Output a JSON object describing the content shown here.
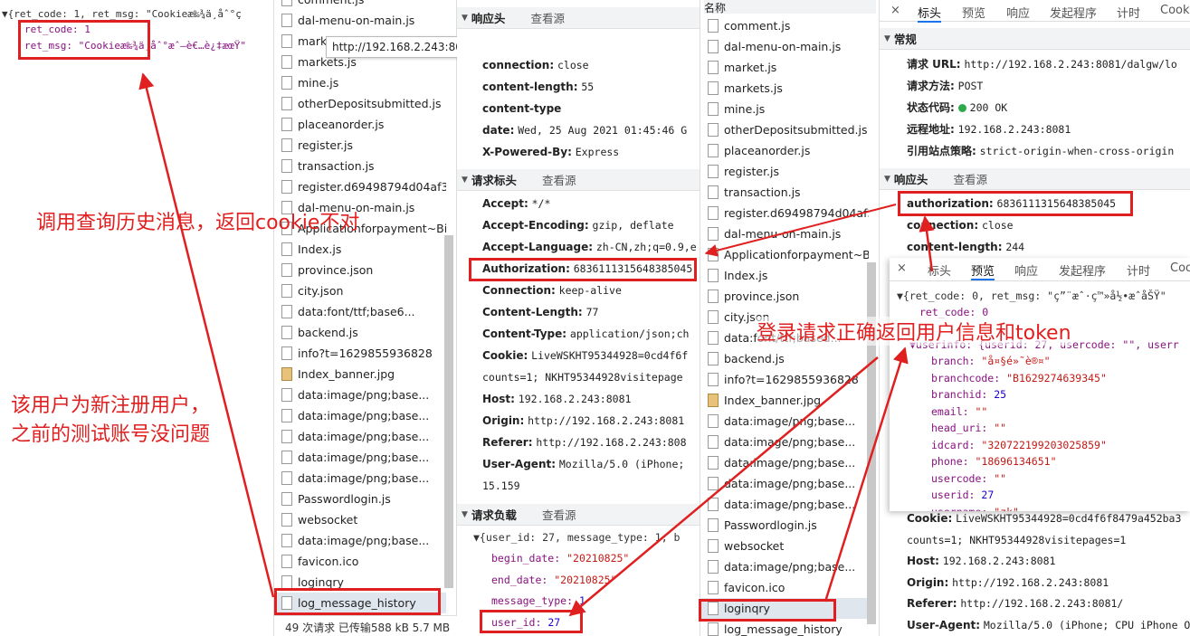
{
  "left_json": {
    "summary": "▼{ret_code: 1, ret_msg: \"Cookieæ‰¾ä¸åˆ°ç",
    "line1": "ret_code: 1",
    "line2": "ret_msg: \"Cookieæ‰¾ä¸åˆ°æˆ–è€…è¿‡æœŸ\""
  },
  "left_files": [
    "comment.js",
    "dal-menu-on-main.js",
    "market.js",
    "markets.js",
    "mine.js",
    "otherDepositsubmitted.js",
    "placeanorder.js",
    "register.js",
    "transaction.js",
    "register.d69498794d04af3c",
    "dal-menu-on-main.js",
    "Applicationforpayment~Bi.",
    "Index.js",
    "province.json",
    "city.json",
    "data:font/ttf;base6...",
    "backend.js",
    "info?t=1629855936828",
    "Index_banner.jpg",
    "data:image/png;base...",
    "data:image/png;base...",
    "data:image/png;base...",
    "data:image/png;base...",
    "data:image/png;base...",
    "Passwordlogin.js",
    "websocket",
    "data:image/png;base...",
    "favicon.ico",
    "loginqry",
    "log_message_history"
  ],
  "left_status": "49 次请求  已传输588 kB  5.7 MB",
  "tooltip": "http://192.168.2.243:8081/js/dal-menu-on-main.js",
  "mid": {
    "resp_header": "响应头",
    "view_source": "查看源",
    "resp_rows": [
      {
        "k": "connection:",
        "v": "close"
      },
      {
        "k": "content-length:",
        "v": "55"
      },
      {
        "k": "content-type",
        "v": ""
      },
      {
        "k": "date:",
        "v": "Wed, 25 Aug 2021 01:45:46 G"
      },
      {
        "k": "X-Powered-By:",
        "v": "Express"
      }
    ],
    "req_header": "请求标头",
    "req_rows": [
      {
        "k": "Accept:",
        "v": "*/*"
      },
      {
        "k": "Accept-Encoding:",
        "v": "gzip, deflate"
      },
      {
        "k": "Accept-Language:",
        "v": "zh-CN,zh;q=0.9,e"
      },
      {
        "k": "Authorization:",
        "v": "6836111315648385045"
      },
      {
        "k": "Connection:",
        "v": "keep-alive"
      },
      {
        "k": "Content-Length:",
        "v": "77"
      },
      {
        "k": "Content-Type:",
        "v": "application/json;ch"
      },
      {
        "k": "Cookie:",
        "v": "LiveWSKHT95344928=0cd4f6f"
      },
      {
        "k": "",
        "v": "counts=1; NKHT95344928visitepage"
      },
      {
        "k": "Host:",
        "v": "192.168.2.243:8081"
      },
      {
        "k": "Origin:",
        "v": "http://192.168.2.243:8081"
      },
      {
        "k": "Referer:",
        "v": "http://192.168.2.243:808"
      },
      {
        "k": "User-Agent:",
        "v": "Mozilla/5.0 (iPhone;"
      },
      {
        "k": "",
        "v": "15.159"
      }
    ],
    "payload_header": "请求负载",
    "payload_summary": "▼{user_id: 27, message_type: 1, b",
    "payload_rows": [
      {
        "k": "begin_date:",
        "v": "\"20210825\""
      },
      {
        "k": "end_date:",
        "v": "\"20210825\""
      },
      {
        "k": "message_type:",
        "v": "1"
      },
      {
        "k": "user_id:",
        "v": "27"
      }
    ]
  },
  "right_files_header": "名称",
  "right_files": [
    "comment.js",
    "dal-menu-on-main.js",
    "market.js",
    "markets.js",
    "mine.js",
    "otherDepositsubmitted.js",
    "placeanorder.js",
    "register.js",
    "transaction.js",
    "register.d69498794d04af3c",
    "dal-menu-on-main.js",
    "Applicationforpayment~Bi.",
    "Index.js",
    "province.json",
    "city.json",
    "data:font/ttf;based...",
    "backend.js",
    "info?t=1629855936828",
    "Index_banner.jpg",
    "data:image/png;base...",
    "data:image/png;base...",
    "data:image/png;base...",
    "data:image/png;base...",
    "data:image/png;base...",
    "Passwordlogin.js",
    "websocket",
    "data:image/png;base...",
    "favicon.ico",
    "loginqry",
    "log_message_history"
  ],
  "right": {
    "tabs": [
      "×",
      "标头",
      "预览",
      "响应",
      "发起程序",
      "计时",
      "Cook"
    ],
    "general": "常规",
    "gen_rows": [
      {
        "k": "请求 URL:",
        "v": "http://192.168.2.243:8081/dalgw/lo"
      },
      {
        "k": "请求方法:",
        "v": "POST"
      },
      {
        "k": "状态代码:",
        "v": "200 OK"
      },
      {
        "k": "远程地址:",
        "v": "192.168.2.243:8081"
      },
      {
        "k": "引用站点策略:",
        "v": "strict-origin-when-cross-origin"
      }
    ],
    "resp_header": "响应头",
    "view_source": "查看源",
    "auth_k": "authorization:",
    "auth_v": "6836111315648385045",
    "resp_rows": [
      {
        "k": "connection:",
        "v": "close"
      },
      {
        "k": "content-length:",
        "v": "244"
      }
    ],
    "lower_rows": [
      {
        "k": "Cookie:",
        "v": "LiveWSKHT95344928=0cd4f6f8479a452ba3"
      },
      {
        "k": "",
        "v": "counts=1; NKHT95344928visitepages=1"
      },
      {
        "k": "Host:",
        "v": "192.168.2.243:8081"
      },
      {
        "k": "Origin:",
        "v": "http://192.168.2.243:8081"
      },
      {
        "k": "Referer:",
        "v": "http://192.168.2.243:8081/"
      },
      {
        "k": "User-Agent:",
        "v": "Mozilla/5.0 (iPhone; CPU iPhone O"
      }
    ]
  },
  "preview": {
    "tabs": [
      "×",
      "标头",
      "预览",
      "响应",
      "发起程序",
      "计时",
      "Coo"
    ],
    "summary": "▼{ret_code: 0, ret_msg: \"ç”¨æˆ·ç™»å½•æˆåŠŸ\"",
    "ret_code": "ret_code: 0",
    "userinfo": "▼userinfo: {userid: 27, usercode: \"\", userr",
    "rows": [
      {
        "k": "branch:",
        "v": "\"å¤§é»˜è®¤\""
      },
      {
        "k": "branchcode:",
        "v": "\"B1629274639345\""
      },
      {
        "k": "branchid:",
        "v": "25"
      },
      {
        "k": "email:",
        "v": "\"\""
      },
      {
        "k": "head_uri:",
        "v": "\"\""
      },
      {
        "k": "idcard:",
        "v": "\"320722199203025859\""
      },
      {
        "k": "phone:",
        "v": "\"18696134651\""
      },
      {
        "k": "usercode:",
        "v": "\"\""
      },
      {
        "k": "userid:",
        "v": "27"
      },
      {
        "k": "username:",
        "v": "\"zk\""
      }
    ]
  },
  "annotations": {
    "a1": "调用查询历史消息，返回cookie不对",
    "a2_l1": "该用户为新注册用户，",
    "a2_l2": "之前的测试账号没问题",
    "a3": "登录请求正确返回用户信息和token"
  },
  "colors": {
    "annotation": "#e02020",
    "devtools_header": "#f1f3f4",
    "status_green": "#2eaa4a"
  }
}
